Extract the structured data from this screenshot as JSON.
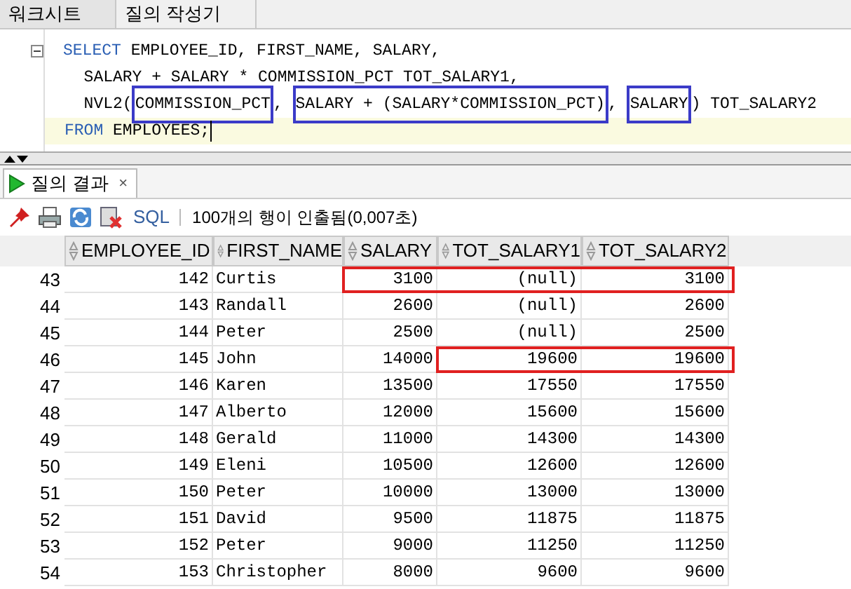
{
  "tabs": [
    {
      "label": "워크시트",
      "selected": true
    },
    {
      "label": "질의 작성기",
      "selected": false
    }
  ],
  "editor": {
    "lines": [
      {
        "current": false,
        "segments": [
          {
            "kind": "keyword",
            "text": "SELECT"
          },
          {
            "kind": "plain",
            "text": " EMPLOYEE_ID, FIRST_NAME, SALARY,"
          }
        ]
      },
      {
        "current": false,
        "segments": [
          {
            "kind": "plain",
            "text": "  SALARY + SALARY * COMMISSION_PCT TOT_SALARY1,"
          }
        ]
      },
      {
        "current": false,
        "segments": [
          {
            "kind": "plain",
            "text": "  NVL2("
          },
          {
            "kind": "boxed",
            "text": "COMMISSION_PCT"
          },
          {
            "kind": "plain",
            "text": ", "
          },
          {
            "kind": "boxed",
            "text": "SALARY + (SALARY*COMMISSION_PCT)"
          },
          {
            "kind": "plain",
            "text": ", "
          },
          {
            "kind": "boxed",
            "text": "SALARY"
          },
          {
            "kind": "plain",
            "text": ") TOT_SALARY2"
          }
        ]
      },
      {
        "current": true,
        "segments": [
          {
            "kind": "keyword",
            "text": "FROM"
          },
          {
            "kind": "plain",
            "text": " EMPLOYEES;"
          }
        ]
      }
    ]
  },
  "result_tab": {
    "label": "질의 결과",
    "close": "×"
  },
  "toolbar": {
    "sql_label": "SQL",
    "status": "100개의 행이 인출됨(0,007초)"
  },
  "table": {
    "columns": [
      "EMPLOYEE_ID",
      "FIRST_NAME",
      "SALARY",
      "TOT_SALARY1",
      "TOT_SALARY2"
    ],
    "rows": [
      {
        "num": "43",
        "cells": [
          "142",
          "Curtis",
          "3100",
          "(null)",
          "3100"
        ],
        "boxed": [
          false,
          false,
          true,
          true,
          true
        ]
      },
      {
        "num": "44",
        "cells": [
          "143",
          "Randall",
          "2600",
          "(null)",
          "2600"
        ],
        "boxed": []
      },
      {
        "num": "45",
        "cells": [
          "144",
          "Peter",
          "2500",
          "(null)",
          "2500"
        ],
        "boxed": []
      },
      {
        "num": "46",
        "cells": [
          "145",
          "John",
          "14000",
          "19600",
          "19600"
        ],
        "boxed": [
          false,
          false,
          false,
          true,
          true
        ]
      },
      {
        "num": "47",
        "cells": [
          "146",
          "Karen",
          "13500",
          "17550",
          "17550"
        ],
        "boxed": []
      },
      {
        "num": "48",
        "cells": [
          "147",
          "Alberto",
          "12000",
          "15600",
          "15600"
        ],
        "boxed": []
      },
      {
        "num": "49",
        "cells": [
          "148",
          "Gerald",
          "11000",
          "14300",
          "14300"
        ],
        "boxed": []
      },
      {
        "num": "50",
        "cells": [
          "149",
          "Eleni",
          "10500",
          "12600",
          "12600"
        ],
        "boxed": []
      },
      {
        "num": "51",
        "cells": [
          "150",
          "Peter",
          "10000",
          "13000",
          "13000"
        ],
        "boxed": []
      },
      {
        "num": "52",
        "cells": [
          "151",
          "David",
          "9500",
          "11875",
          "11875"
        ],
        "boxed": []
      },
      {
        "num": "53",
        "cells": [
          "152",
          "Peter",
          "9000",
          "11250",
          "11250"
        ],
        "boxed": []
      },
      {
        "num": "54",
        "cells": [
          "153",
          "Christopher",
          "8000",
          "9600",
          "9600"
        ],
        "boxed": []
      }
    ]
  }
}
